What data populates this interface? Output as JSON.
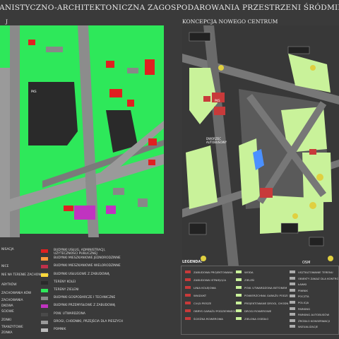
{
  "title": "ANISTYCZNO-ARCHITEKTONICZNA ZAGOSPODAROWANIA PRZESTRZENI ŚRÓDMIEJSKIEJ MIAS",
  "left_panel": {
    "title": "J",
    "labels": {
      "pks": "PKS"
    },
    "legend": [
      {
        "label": "BUDYNKI USŁUG, ADMINISTRACJI, UŻYTECZNOŚCI PUBLICZNEJ",
        "color": "#e02020"
      },
      {
        "label": "BUDYNKI MIESZKANIOWE JEDNORODZINNE",
        "color": "#ff9a3c"
      },
      {
        "label": "BUDYNKI MIESZKANIOWE WIELORODZINNE",
        "color": "#c0304a"
      },
      {
        "label": "BUDYNKI USŁUGOWE Z ZABUDOWĄ",
        "color": "#ffd93b"
      },
      {
        "label": "TERENY KOLEI",
        "color": "#2a2a2a"
      },
      {
        "label": "TERENY ZIELENI",
        "color": "#2ee85a"
      },
      {
        "label": "BUDYNKI GOSPODARCZE I TECHNICZNE",
        "color": "#8a8a8a"
      },
      {
        "label": "BUDYNKI PRZEMYSŁOWE Z ZABUDOWĄ",
        "color": "#c033c0"
      },
      {
        "label": "POW. UTWARDZONA",
        "color": "#4a4a4a"
      },
      {
        "label": "DROGI, CHODNIKI, PRZEJŚCIA DLA PIESZYCH",
        "color": "#9a9a9a"
      },
      {
        "label": "POMNIK",
        "color": "#bbbbbb"
      }
    ],
    "left_legend": [
      "NISACJA",
      "NICE",
      "NIE NA TERENIE ZACHOWANIA",
      "ABYTKÓW",
      "ZACHOWANIA KÓW",
      "ZACHOWANIA",
      "DKOWA",
      "ŚCIOWE",
      "ZONKI",
      "TRANZYTOWE",
      "ZONKA"
    ]
  },
  "right_panel": {
    "title": "KONCEPCJA NOWEGO CENTRUM",
    "labels": {
      "pks": "PKS",
      "dworzec": "DWORZEC AUTOBUSOWY",
      "osm": "OSM",
      "pks2": "PKS"
    },
    "legend_title": "LEGENDA:",
    "legend_col1": [
      "ZABUDOWA PROJEKTOWANA",
      "ZABUDOWA ISTNIEJĄCA",
      "LINIA KOLEJOWA",
      "WIADUKT",
      "CIĄGI PIESZE",
      "OBRYS GARAŻU PODZIEMNEGO",
      "ŚCIEŻKA ROWEROWA"
    ],
    "legend_col2": [
      "WODA",
      "ZIELEŃ",
      "POW. UTWARDZONA BETONEM",
      "POWIERZCHNIA GARAŻU PODZIEMNEGO",
      "PROJEKTOWANE DROGI, CHODNIKI, PRZEJŚCIA DLA PIESZYCH",
      "DROGI ROWEROWE",
      "ZIELONA OSEDŁO"
    ],
    "legend_col3": [
      "USZTALTOWANIE TERENU",
      "OBIEKTY ZAKAZ DLA KONTROLI",
      "ŁAWKI",
      "PIWNIK",
      "POCZTA",
      "POLICJA",
      "PARKING",
      "PARKING AUTOBUSÓW",
      "ŹRÓDŁO KONSERWACJI",
      "WIZUALIZACJE"
    ]
  },
  "colors": {
    "green": "#2ee85a",
    "pale_green": "#c9f29a",
    "dark": "#333333",
    "red": "#e02020",
    "magenta": "#c033c0"
  }
}
